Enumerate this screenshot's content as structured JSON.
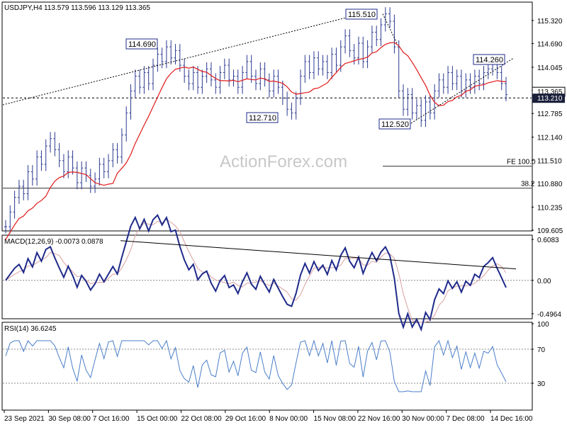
{
  "header": {
    "symbol": "USDJPY,H4",
    "ohlc": "113.579 113.596 113.129 113.365"
  },
  "watermark": "ActionForex.com",
  "colors": {
    "price": "#2b3a8f",
    "ma": "#e01818",
    "macd": "#1f2a8a",
    "signal": "#d9a0a0",
    "rsi": "#4a7ec8",
    "box_border": "#1f2a8a",
    "highlight_box": "#1a1f3a"
  },
  "chart_data": [
    {
      "type": "line",
      "name": "price",
      "ylim": [
        109.605,
        115.8
      ],
      "yticks": [
        "115.320",
        "114.690",
        "114.045",
        "113.415",
        "112.785",
        "112.140",
        "111.510",
        "110.880",
        "110.235",
        "109.605"
      ],
      "price_axis_labels": {
        "current": "113.365",
        "level": "113.210"
      },
      "close": [
        109.7,
        110.1,
        110.5,
        110.8,
        110.6,
        111.2,
        111.0,
        111.6,
        111.4,
        111.9,
        112.1,
        111.8,
        111.5,
        111.2,
        111.6,
        111.3,
        110.9,
        111.3,
        111.1,
        110.8,
        111.0,
        111.4,
        111.2,
        111.5,
        111.8,
        111.6,
        112.2,
        112.8,
        113.4,
        113.8,
        113.5,
        113.9,
        113.6,
        114.1,
        114.4,
        114.2,
        114.6,
        114.3,
        114.5,
        114.1,
        113.8,
        113.6,
        113.9,
        113.5,
        113.8,
        114.0,
        113.7,
        113.5,
        113.9,
        114.1,
        113.7,
        113.8,
        113.5,
        113.9,
        114.2,
        113.8,
        113.6,
        114.0,
        113.7,
        113.4,
        113.8,
        113.5,
        113.2,
        112.9,
        112.8,
        113.2,
        113.8,
        114.2,
        113.9,
        114.3,
        114.0,
        114.2,
        113.9,
        114.4,
        114.1,
        114.6,
        114.9,
        114.5,
        114.3,
        114.7,
        114.2,
        114.6,
        115.0,
        114.8,
        115.2,
        115.5,
        115.3,
        114.6,
        113.4,
        112.9,
        113.3,
        112.8,
        113.0,
        112.6,
        113.1,
        112.8,
        113.4,
        113.7,
        113.5,
        113.9,
        113.6,
        113.8,
        113.4,
        113.7,
        113.5,
        113.8,
        113.6,
        113.9,
        114.0,
        114.2,
        113.9,
        113.6,
        113.3
      ],
      "ma_overlay": "red moving average",
      "annotations": {
        "high_a": "114.690",
        "low_a": "112.710",
        "high_b": "115.510",
        "low_b": "112.520",
        "high_c": "114.260",
        "fe_label": "FE 100.0",
        "fe_value": 111.35,
        "fib_label": "38.2",
        "fib_value": 110.75,
        "support_value": 113.21
      }
    },
    {
      "type": "line",
      "name": "MACD(12,26,9)",
      "header": "MACD(12,26,9) -0.0073 0.0878",
      "ylim": [
        -0.55,
        0.65
      ],
      "yticks": [
        "0.6083",
        "0.00",
        "-0.4964"
      ]
    },
    {
      "type": "line",
      "name": "RSI(14)",
      "header": "RSI(14) 36.6245",
      "ylim": [
        0,
        100
      ],
      "yticks": [
        "100",
        "70",
        "30",
        "0"
      ]
    }
  ],
  "xaxis": {
    "labels": [
      "23 Sep 2021",
      "30 Sep 08:00",
      "7 Oct 16:00",
      "15 Oct 00:00",
      "22 Oct 08:00",
      "29 Oct 16:00",
      "8 Nov 00:00",
      "15 Nov 08:00",
      "22 Nov 16:00",
      "30 Nov 00:00",
      "7 Dec 08:00",
      "14 Dec 16:00"
    ]
  }
}
